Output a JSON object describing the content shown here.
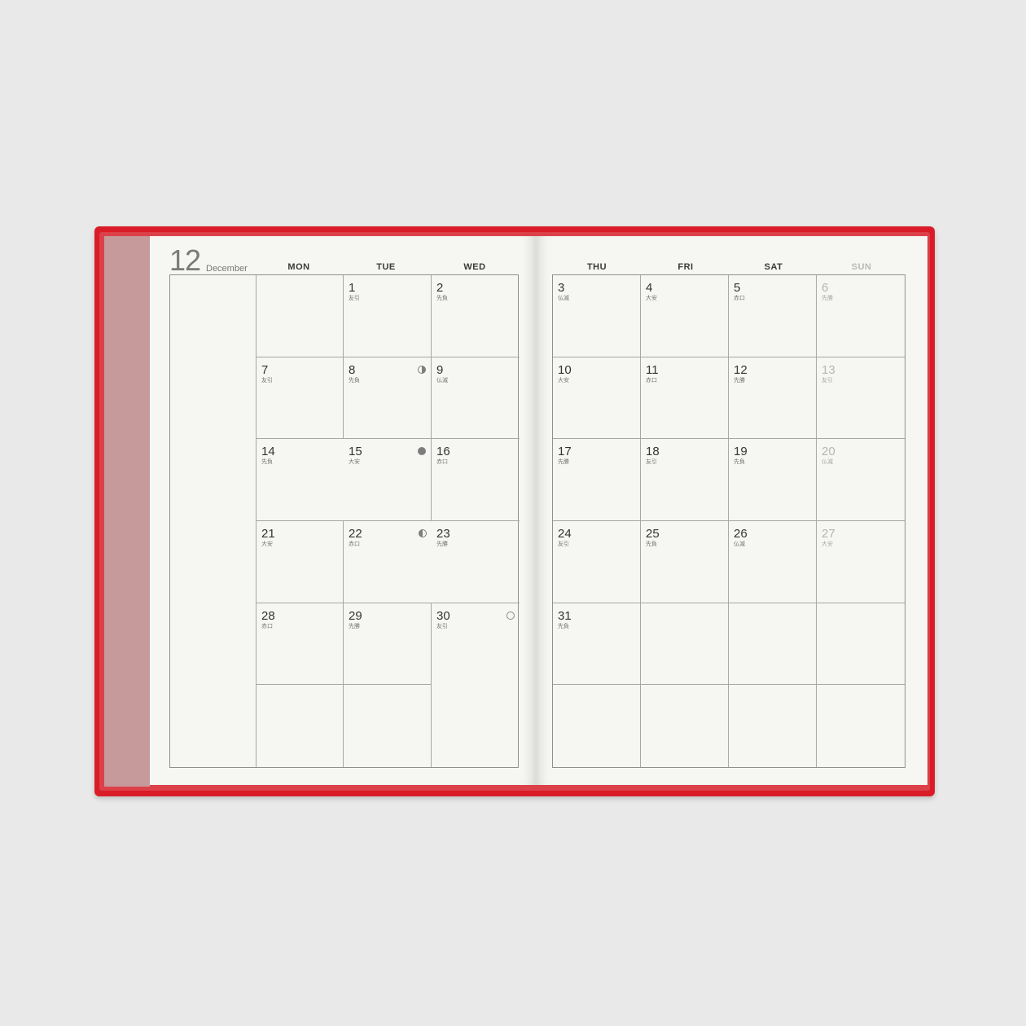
{
  "month": {
    "number": "12",
    "name": "December"
  },
  "weekdays": {
    "left": [
      "MON",
      "TUE",
      "WED"
    ],
    "right": [
      "THU",
      "FRI",
      "SAT",
      "SUN"
    ]
  },
  "left_rows": [
    [
      {
        "d": "",
        "r": ""
      },
      {
        "d": "1",
        "r": "友引"
      },
      {
        "d": "2",
        "r": "先負"
      }
    ],
    [
      {
        "d": "7",
        "r": "友引"
      },
      {
        "d": "8",
        "r": "先負",
        "moon": "first"
      },
      {
        "d": "9",
        "r": "仏滅"
      }
    ],
    [
      {
        "d": "14",
        "r": "先負"
      },
      {
        "d": "15",
        "r": "大安",
        "moon": "full-new"
      },
      {
        "d": "16",
        "r": "赤口"
      }
    ],
    [
      {
        "d": "21",
        "r": "大安"
      },
      {
        "d": "22",
        "r": "赤口",
        "moon": "last"
      },
      {
        "d": "23",
        "r": "先勝"
      }
    ],
    [
      {
        "d": "28",
        "r": "赤口"
      },
      {
        "d": "29",
        "r": "先勝"
      },
      {
        "d": "30",
        "r": "友引",
        "moon": "empty"
      }
    ],
    [
      {
        "d": "",
        "r": ""
      },
      {
        "d": "",
        "r": ""
      },
      {
        "d": "",
        "r": ""
      }
    ]
  ],
  "right_rows": [
    [
      {
        "d": "3",
        "r": "仏滅"
      },
      {
        "d": "4",
        "r": "大安"
      },
      {
        "d": "5",
        "r": "赤口"
      },
      {
        "d": "6",
        "r": "先勝"
      }
    ],
    [
      {
        "d": "10",
        "r": "大安"
      },
      {
        "d": "11",
        "r": "赤口"
      },
      {
        "d": "12",
        "r": "先勝"
      },
      {
        "d": "13",
        "r": "友引"
      }
    ],
    [
      {
        "d": "17",
        "r": "先勝"
      },
      {
        "d": "18",
        "r": "友引"
      },
      {
        "d": "19",
        "r": "先負"
      },
      {
        "d": "20",
        "r": "仏滅"
      }
    ],
    [
      {
        "d": "24",
        "r": "友引"
      },
      {
        "d": "25",
        "r": "先負"
      },
      {
        "d": "26",
        "r": "仏滅"
      },
      {
        "d": "27",
        "r": "大安"
      }
    ],
    [
      {
        "d": "31",
        "r": "先負"
      },
      {
        "d": "",
        "r": ""
      },
      {
        "d": "",
        "r": ""
      },
      {
        "d": "",
        "r": ""
      }
    ],
    [
      {
        "d": "",
        "r": ""
      },
      {
        "d": "",
        "r": ""
      },
      {
        "d": "",
        "r": ""
      },
      {
        "d": "",
        "r": ""
      }
    ]
  ],
  "colors": {
    "background": "#e9e9e9",
    "cover": "#d91c27",
    "paper": "#f6f6f2",
    "sunday": "#b5b5b5"
  },
  "moon_icons": {
    "first": "first-quarter-moon-icon",
    "full-new": "filled-moon-icon",
    "last": "last-quarter-moon-icon",
    "empty": "empty-moon-icon"
  }
}
